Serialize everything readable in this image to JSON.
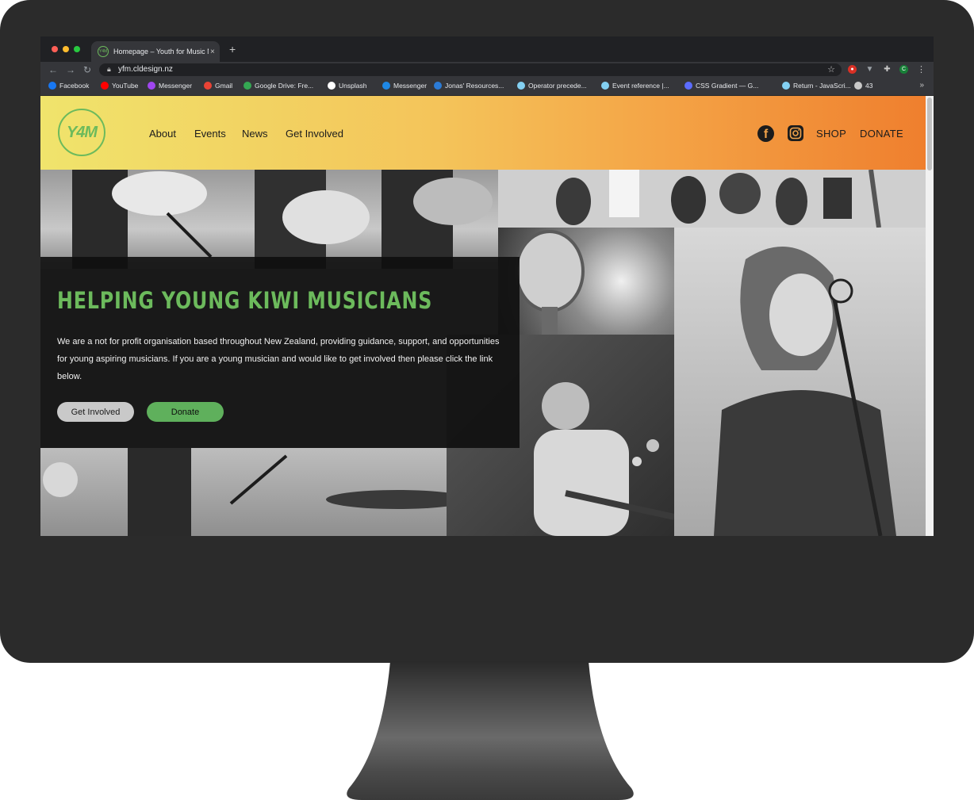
{
  "browser": {
    "tab_title": "Homepage – Youth for Music N",
    "tab_close": "×",
    "new_tab": "+",
    "url": "yfm.cldesign.nz",
    "nav": {
      "back": "←",
      "forward": "→",
      "reload": "↻"
    },
    "extension_count": "43",
    "profile_initial": "C",
    "bookmarks": [
      {
        "label": "Facebook",
        "icon": "facebook-icon",
        "color": "#1877f2"
      },
      {
        "label": "YouTube",
        "icon": "youtube-icon",
        "color": "#ff0000"
      },
      {
        "label": "Messenger",
        "icon": "messenger-icon",
        "color": "#a046f0"
      },
      {
        "label": "Gmail",
        "icon": "gmail-icon",
        "color": "#ea4335"
      },
      {
        "label": "Google Drive: Fre...",
        "icon": "drive-icon",
        "color": "#34a853"
      },
      {
        "label": "Unsplash",
        "icon": "unsplash-icon",
        "color": "#ffffff"
      },
      {
        "label": "Messenger",
        "icon": "messenger-icon",
        "color": "#1e88e5"
      },
      {
        "label": "Jonas' Resources...",
        "icon": "heart-icon",
        "color": "#2b7bd6"
      },
      {
        "label": "Operator precede...",
        "icon": "mdn-icon",
        "color": "#83d0f2"
      },
      {
        "label": "Event reference |...",
        "icon": "mdn-icon",
        "color": "#83d0f2"
      },
      {
        "label": "CSS Gradient — G...",
        "icon": "gradient-icon",
        "color": "#5b6cff"
      },
      {
        "label": "Return - JavaScri...",
        "icon": "mdn-icon",
        "color": "#83d0f2"
      },
      {
        "label": "43",
        "icon": "cube-icon",
        "color": "#c8c8c8"
      }
    ],
    "bookmarks_more": "»"
  },
  "site": {
    "logo_text": "Y4M",
    "nav": [
      "About",
      "Events",
      "News",
      "Get Involved"
    ],
    "shop": "SHOP",
    "donate": "DONATE",
    "hero": {
      "title": "HELPING YOUNG KIWI MUSICIANS",
      "text": "We are a not for profit organisation based throughout New Zealand, providing guidance, support, and opportunities for young aspiring musicians. If you are a young musician and would like to get involved then please click the link below.",
      "button_primary": "Get Involved",
      "button_secondary": "Donate"
    }
  },
  "colors": {
    "brand_green": "#6cba5c",
    "header_gradient_start": "#f0e46c",
    "header_gradient_end": "#ef7f2e",
    "monitor": "#2b2b2b"
  }
}
